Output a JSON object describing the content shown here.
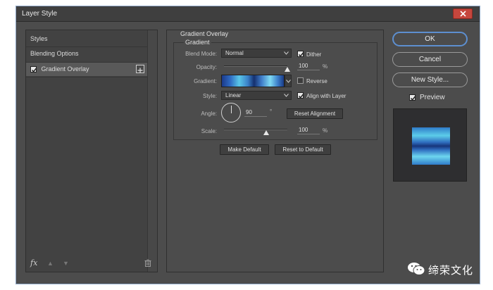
{
  "window": {
    "title": "Layer Style"
  },
  "left_panel": {
    "items": [
      {
        "label": "Styles"
      },
      {
        "label": "Blending Options"
      },
      {
        "label": "Gradient Overlay",
        "checked": true
      }
    ],
    "bottom": {
      "fx_label": "fx"
    }
  },
  "gradient_overlay": {
    "section_title": "Gradient Overlay",
    "group_title": "Gradient",
    "blend_mode": {
      "label": "Blend Mode:",
      "value": "Normal"
    },
    "dither": {
      "label": "Dither",
      "checked": true
    },
    "opacity": {
      "label": "Opacity:",
      "value": "100",
      "unit": "%",
      "level": 1.0
    },
    "gradient": {
      "label": "Gradient:"
    },
    "reverse": {
      "label": "Reverse",
      "checked": false
    },
    "style": {
      "label": "Style:",
      "value": "Linear"
    },
    "align_with_layer": {
      "label": "Align with Layer",
      "checked": true
    },
    "angle": {
      "label": "Angle:",
      "value": "90",
      "unit": "°"
    },
    "reset_alignment_label": "Reset Alignment",
    "scale": {
      "label": "Scale:",
      "value": "100",
      "unit": "%",
      "level": 0.67
    },
    "make_default_label": "Make Default",
    "reset_to_default_label": "Reset to Default"
  },
  "actions": {
    "ok_label": "OK",
    "cancel_label": "Cancel",
    "new_style_label": "New Style...",
    "preview": {
      "label": "Preview",
      "checked": true
    }
  },
  "watermark": {
    "text": "缔荣文化"
  },
  "colors": {
    "dialog_bg": "#4c4c4c",
    "accent_focus": "#5d8fd0",
    "close_red": "#c6463d",
    "gradient_dark": "#17357a",
    "gradient_light": "#6dd6ef"
  }
}
